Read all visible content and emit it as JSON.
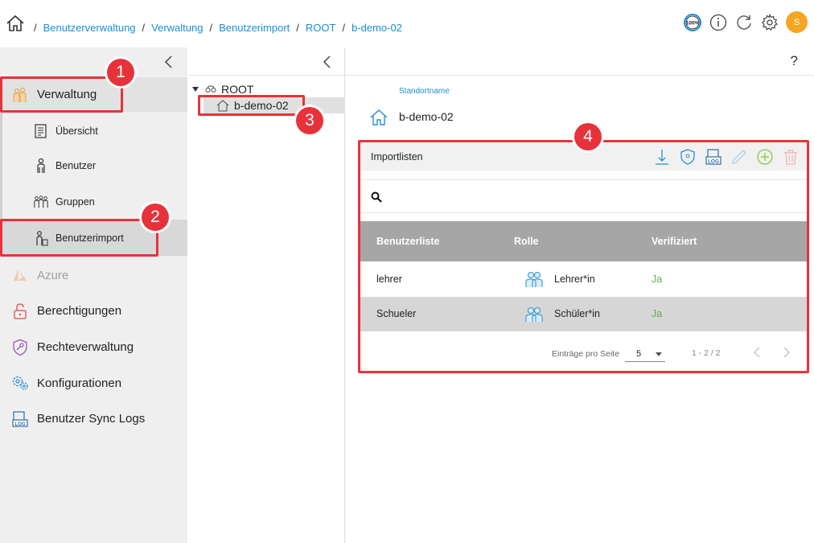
{
  "breadcrumb": [
    "Benutzerverwaltung",
    "Verwaltung",
    "Benutzerimport",
    "ROOT",
    "b-demo-02"
  ],
  "header": {
    "zoom_label": "100%",
    "avatar_initial": "S"
  },
  "sidebar": {
    "items": [
      {
        "label": "Verwaltung",
        "icon": "admin-icon"
      },
      {
        "label": "Übersicht",
        "icon": "overview-icon"
      },
      {
        "label": "Benutzer",
        "icon": "user-icon"
      },
      {
        "label": "Gruppen",
        "icon": "groups-icon"
      },
      {
        "label": "Benutzerimport",
        "icon": "user-import-icon"
      },
      {
        "label": "Azure",
        "icon": "azure-icon"
      },
      {
        "label": "Berechtigungen",
        "icon": "lock-icon"
      },
      {
        "label": "Rechteverwaltung",
        "icon": "shield-key-icon"
      },
      {
        "label": "Konfigurationen",
        "icon": "gears-icon"
      },
      {
        "label": "Benutzer Sync Logs",
        "icon": "log-icon"
      }
    ]
  },
  "tree": {
    "root": "ROOT",
    "child": "b-demo-02"
  },
  "main": {
    "help": "?",
    "location_label": "Standortname",
    "location_name": "b-demo-02",
    "card_title": "Importlisten",
    "search_placeholder": "",
    "columns": [
      "Benutzerliste",
      "Rolle",
      "Verifiziert"
    ],
    "rows": [
      {
        "list": "lehrer",
        "role": "Lehrer*in",
        "verified": "Ja"
      },
      {
        "list": "Schueler",
        "role": "Schüler*in",
        "verified": "Ja"
      }
    ],
    "pager": {
      "label": "Einträge pro Seite",
      "page_size": "5",
      "range": "1 - 2 / 2"
    }
  },
  "annotations": [
    "1",
    "2",
    "3",
    "4"
  ],
  "colors": {
    "accent": "#1a8fd6",
    "highlight": "#e8323a",
    "avatar": "#f5a623",
    "verified": "#6aa84f"
  }
}
